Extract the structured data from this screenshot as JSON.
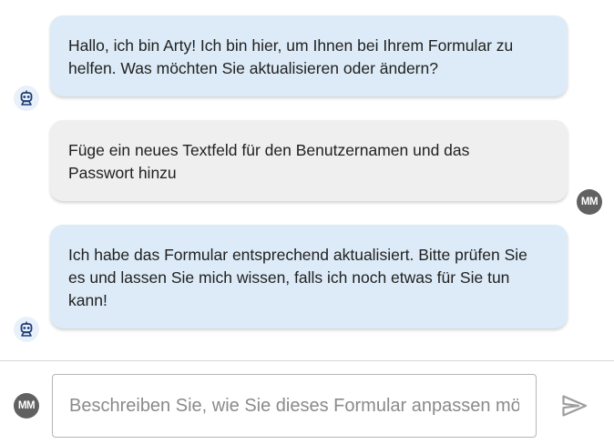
{
  "messages": [
    {
      "sender": "bot",
      "avatar_icon": "robot-icon",
      "lines": [
        "Hallo, ich bin Arty! Ich bin hier, um Ihnen bei Ihrem Formular zu",
        "helfen. Was möchten Sie aktualisieren oder ändern?"
      ]
    },
    {
      "sender": "user",
      "avatar_initials": "MM",
      "lines": [
        "Füge ein neues Textfeld für den Benutzernamen und das",
        "Passwort hinzu"
      ]
    },
    {
      "sender": "bot",
      "avatar_icon": "robot-icon",
      "lines": [
        "Ich habe das Formular entsprechend aktualisiert. Bitte prüfen Sie",
        "es und lassen Sie mich wissen, falls ich noch etwas für Sie tun",
        "kann!"
      ]
    }
  ],
  "composer": {
    "avatar_initials": "MM",
    "placeholder": "Beschreiben Sie, wie Sie dieses Formular anpassen möchten",
    "value": "",
    "send_icon": "send-icon"
  },
  "colors": {
    "bot_bubble": "#dcebf7",
    "user_bubble": "#efefef",
    "user_avatar": "#616161",
    "bot_icon": "#1f3b73",
    "send_icon": "#9e9e9e"
  }
}
